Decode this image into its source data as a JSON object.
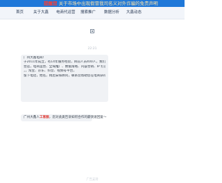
{
  "banner": {
    "highlight": "提醒您",
    "text": "关于市场中出现假冒我司名义对外诈骗的免责声明"
  },
  "nav": {
    "items": [
      "首页",
      "关于大鑫",
      "电商代运营",
      "搜索推广",
      "数据分析",
      "大鑫动态"
    ]
  },
  "chat": {
    "timestamp": "22:21",
    "message1_lines": [
      "广州大鑫电商！",
      "于2011年成立，有14年服务经验，目前人员400人，我们合伙商家致力于电商服务",
      "营店，电商运营、全域推广、数据策略、内容营销、IP 打造、私域直播、客服服务外",
      "，，淘宝、京东、抖音、视频号平台，",
      "留下电话，姓名，稍后安排顾问，联系您帮助您在电商获得成功哦"
    ],
    "message2_prefix": "广州大鑫人",
    "message2_highlight": "工客服",
    "message2_suffix": "，您对此类告诉如何合作的最快速回复～"
  },
  "footer": {
    "text": "广告支持"
  },
  "colors": {
    "banner": "#1f78d9",
    "accent": "#e0312b"
  }
}
